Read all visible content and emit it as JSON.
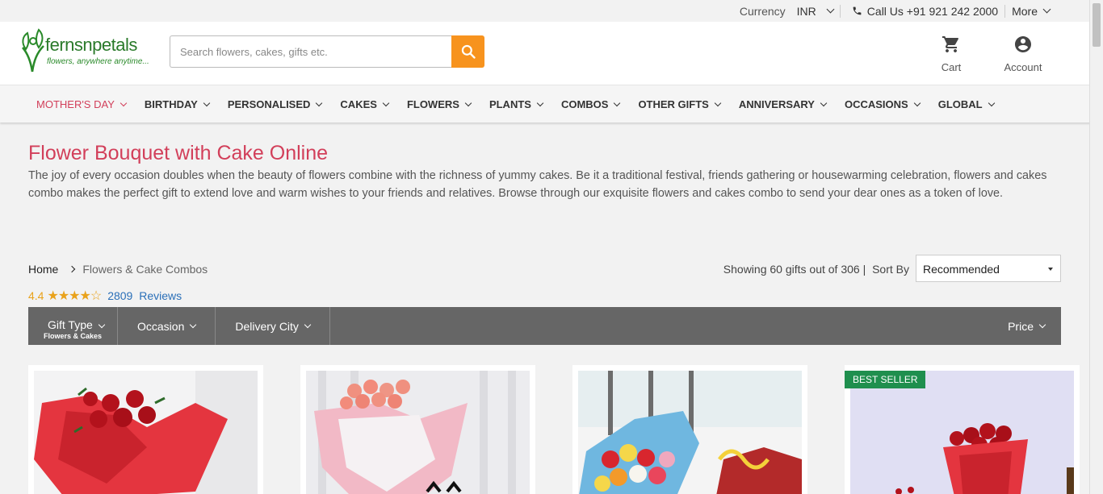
{
  "topbar": {
    "currency_label": "Currency",
    "currency_value": "INR",
    "phone": "Call Us +91 921 242 2000",
    "more": "More"
  },
  "header": {
    "logo_brand": "fernsnpetals",
    "logo_tagline": "flowers, anywhere anytime...",
    "search_placeholder": "Search flowers, cakes, gifts etc.",
    "cart_label": "Cart",
    "account_label": "Account"
  },
  "nav": [
    {
      "label": "MOTHER'S DAY",
      "active": true
    },
    {
      "label": "BIRTHDAY"
    },
    {
      "label": "PERSONALISED"
    },
    {
      "label": "CAKES"
    },
    {
      "label": "FLOWERS"
    },
    {
      "label": "PLANTS"
    },
    {
      "label": "COMBOS"
    },
    {
      "label": "OTHER GIFTS"
    },
    {
      "label": "ANNIVERSARY"
    },
    {
      "label": "OCCASIONS"
    },
    {
      "label": "GLOBAL"
    }
  ],
  "page": {
    "title": "Flower Bouquet with Cake Online",
    "description": "The joy of every occasion doubles when the beauty of flowers combine with the richness of yummy cakes. Be it a traditional festival, friends gathering or housewarming celebration, flowers and cakes combo makes the perfect gift to extend love and warm wishes to your friends and relatives. Browse through our exquisite flowers and cakes combo to send your dear ones as a token of love."
  },
  "breadcrumb": {
    "home": "Home",
    "current": "Flowers & Cake Combos"
  },
  "listing": {
    "showing": "Showing 60 gifts out of 306 |",
    "sort_label": "Sort By",
    "sort_value": "Recommended"
  },
  "rating": {
    "score": "4.4",
    "stars": 4.4,
    "reviews_count": "2809",
    "reviews_label": "Reviews"
  },
  "filters": {
    "gift_type": "Gift Type",
    "gift_type_sub": "Flowers & Cakes",
    "occasion": "Occasion",
    "delivery_city": "Delivery City",
    "price": "Price"
  },
  "products": [
    {
      "badge": ""
    },
    {
      "badge": ""
    },
    {
      "badge": ""
    },
    {
      "badge": "BEST SELLER"
    }
  ],
  "colors": {
    "accent": "#d23f5a",
    "search_button": "#f7931e",
    "filter_bar": "#666666",
    "badge": "#1f8f4e",
    "rating": "#e9a21b",
    "link": "#2a6fb8"
  }
}
